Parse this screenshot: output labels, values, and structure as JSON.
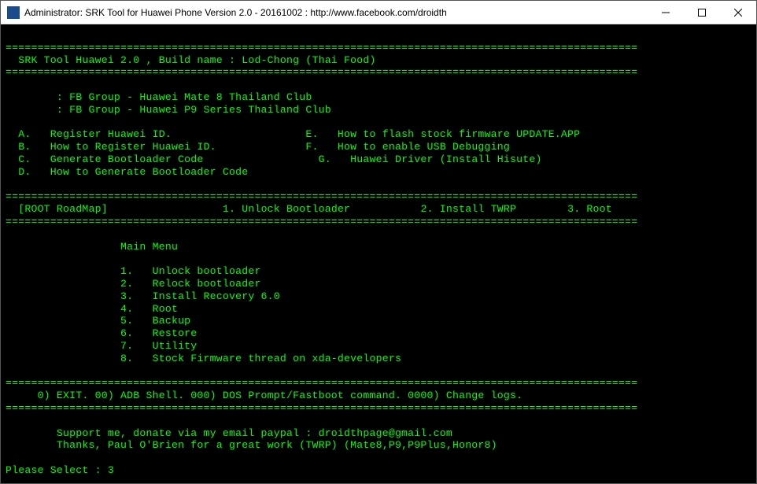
{
  "window": {
    "title": "Administrator:  SRK Tool for Huawei Phone Version 2.0  - 20161002 : http://www.facebook.com/droidth",
    "icon_label": "srk"
  },
  "divider": "===================================================================================================",
  "header": {
    "line1": "  SRK Tool Huawei 2.0 , Build name : Lod-Chong (Thai Food)"
  },
  "fb_groups": {
    "line1": "        : FB Group - Huawei Mate 8 Thailand Club",
    "line2": "        : FB Group - Huawei P9 Series Thailand Club"
  },
  "info_left": {
    "a": "  A.   Register Huawei ID.",
    "b": "  B.   How to Register Huawei ID.",
    "c": "  C.   Generate Bootloader Code",
    "d": "  D.   How to Generate Bootloader Code"
  },
  "info_right": {
    "e": "E.   How to flash stock firmware UPDATE.APP",
    "f": "F.   How to enable USB Debugging",
    "g": "G.   Huawei Driver (Install Hisute)"
  },
  "roadmap": {
    "label": "  [ROOT RoadMap]",
    "step1": "1. Unlock Bootloader",
    "step2": "2. Install TWRP",
    "step3": "3. Root"
  },
  "menu": {
    "title": "                  Main Menu",
    "items": {
      "i1": "                  1.   Unlock bootloader",
      "i2": "                  2.   Relock bootloader",
      "i3": "                  3.   Install Recovery 6.0",
      "i4": "                  4.   Root",
      "i5": "                  5.   Backup",
      "i6": "                  6.   Restore",
      "i7": "                  7.   Utility",
      "i8": "                  8.   Stock Firmware thread on xda-developers"
    }
  },
  "footer_options": "     0) EXIT. 00) ADB Shell. 000) DOS Prompt/Fastboot command. 0000) Change logs.",
  "support": {
    "line1": "        Support me, donate via my email paypal : droidthpage@gmail.com",
    "line2": "        Thanks, Paul O'Brien for a great work (TWRP) (Mate8,P9,P9Plus,Honor8)"
  },
  "prompt": {
    "label": "Please Select : ",
    "value": "3"
  }
}
